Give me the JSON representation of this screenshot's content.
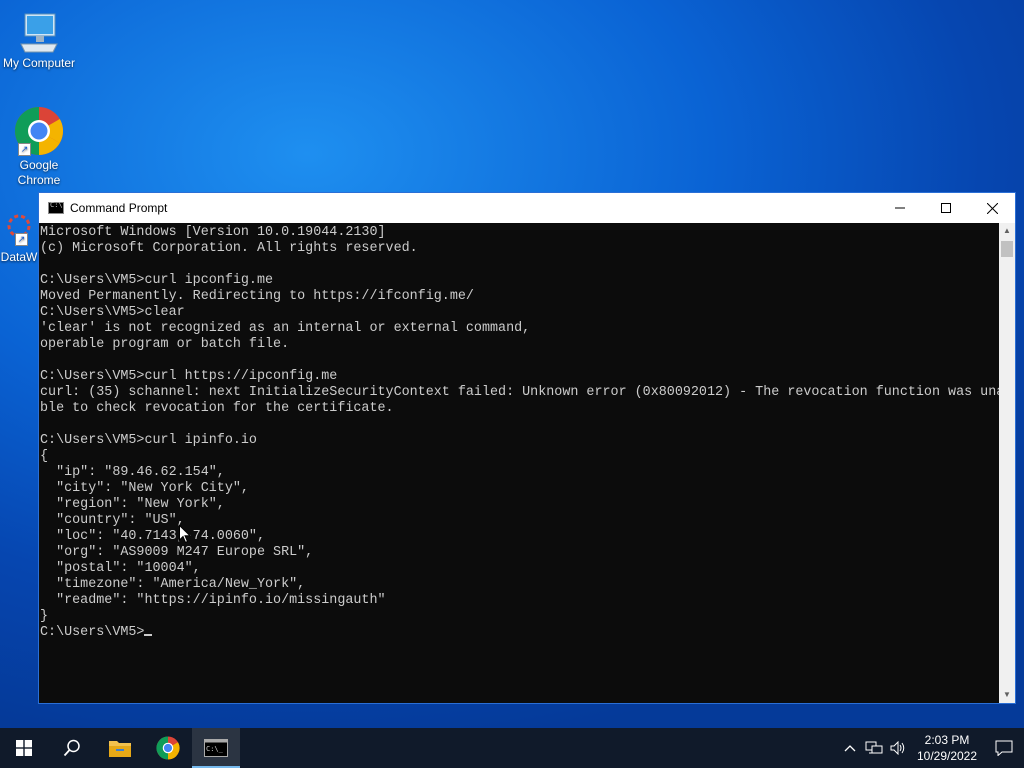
{
  "desktop": {
    "icons": [
      {
        "label": "My Computer"
      },
      {
        "label": "Google Chrome"
      },
      {
        "label": "DataW"
      }
    ]
  },
  "window": {
    "title": "Command Prompt",
    "console_lines": [
      "Microsoft Windows [Version 10.0.19044.2130]",
      "(c) Microsoft Corporation. All rights reserved.",
      "",
      "C:\\Users\\VM5>curl ipconfig.me",
      "Moved Permanently. Redirecting to https://ifconfig.me/",
      "C:\\Users\\VM5>clear",
      "'clear' is not recognized as an internal or external command,",
      "operable program or batch file.",
      "",
      "C:\\Users\\VM5>curl https://ipconfig.me",
      "curl: (35) schannel: next InitializeSecurityContext failed: Unknown error (0x80092012) - The revocation function was una",
      "ble to check revocation for the certificate.",
      "",
      "C:\\Users\\VM5>curl ipinfo.io",
      "{",
      "  \"ip\": \"89.46.62.154\",",
      "  \"city\": \"New York City\",",
      "  \"region\": \"New York\",",
      "  \"country\": \"US\",",
      "  \"loc\": \"40.7143,-74.0060\",",
      "  \"org\": \"AS9009 M247 Europe SRL\",",
      "  \"postal\": \"10004\",",
      "  \"timezone\": \"America/New_York\",",
      "  \"readme\": \"https://ipinfo.io/missingauth\"",
      "}"
    ],
    "prompt": "C:\\Users\\VM5>"
  },
  "taskbar": {
    "clock_time": "2:03 PM",
    "clock_date": "10/29/2022"
  },
  "colors": {
    "console_bg": "#0c0c0c",
    "console_fg": "#cccccc",
    "taskbar_bg": "#101a2a",
    "accent": "#76b9ed"
  }
}
